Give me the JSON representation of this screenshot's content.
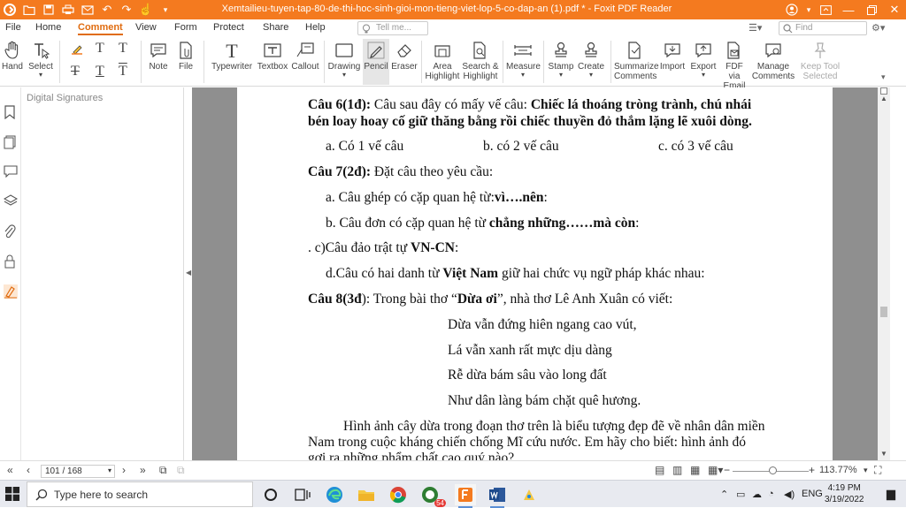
{
  "app": {
    "window_title": "Xemtailieu-tuyen-tap-80-de-thi-hoc-sinh-gioi-mon-tieng-viet-lop-5-co-dap-an (1).pdf * - Foxit PDF Reader",
    "accent_color": "#f47a1f"
  },
  "menu": {
    "tabs": [
      {
        "label": "File"
      },
      {
        "label": "Home"
      },
      {
        "label": "Comment"
      },
      {
        "label": "View"
      },
      {
        "label": "Form"
      },
      {
        "label": "Protect"
      },
      {
        "label": "Share"
      },
      {
        "label": "Help"
      }
    ],
    "active_tab": "Comment",
    "tell_me_placeholder": "Tell me...",
    "find_placeholder": "Find"
  },
  "ribbon": {
    "hand": "Hand",
    "select": "Select",
    "note": "Note",
    "file": "File",
    "typewriter": "Typewriter",
    "textbox": "Textbox",
    "callout": "Callout",
    "drawing": "Drawing",
    "pencil": "Pencil",
    "eraser": "Eraser",
    "area_highlight_1": "Area",
    "area_highlight_2": "Highlight",
    "search_highlight_1": "Search &",
    "search_highlight_2": "Highlight",
    "measure": "Measure",
    "stamp": "Stamp",
    "create": "Create",
    "summarize_1": "Summarize",
    "summarize_2": "Comments",
    "import": "Import",
    "export": "Export",
    "fdf_1": "FDF via",
    "fdf_2": "Email",
    "manage_1": "Manage",
    "manage_2": "Comments",
    "keep_1": "Keep Tool",
    "keep_2": "Selected"
  },
  "sidepanel": {
    "header": "Digital Signatures"
  },
  "document": {
    "lines": [
      {
        "kind": "mixed",
        "parts": [
          {
            "t": "Câu 6(1đ):",
            "b": true
          },
          {
            "t": " Câu sau đây có mấy vế câu: ",
            "b": false
          },
          {
            "t": "Chiếc lá thoáng tròng trành, chú nhái",
            "b": true
          }
        ]
      },
      {
        "kind": "mixed",
        "parts": [
          {
            "t": "bén loay hoay cố giữ thăng bằng rồi chiếc thuyền đỏ thắm lặng lẽ xuôi dòng.",
            "b": true
          }
        ]
      },
      {
        "kind": "choices",
        "a": "a.  Có 1 vế câu",
        "b": "b. có 2 vế câu",
        "c": "c. có 3 vế câu"
      },
      {
        "kind": "mixed",
        "parts": [
          {
            "t": "Câu 7(2đ):",
            "b": true
          },
          {
            "t": " Đặt câu theo yêu cầu:",
            "b": false
          }
        ]
      },
      {
        "kind": "mixed",
        "parts": [
          {
            "t": "a.  Câu ghép có cặp quan hệ từ:",
            "b": false
          },
          {
            "t": "vì….nên",
            "b": true
          },
          {
            "t": ":",
            "b": false
          }
        ]
      },
      {
        "kind": "mixed",
        "parts": [
          {
            "t": "b.  Câu đơn có cặp quan hệ từ ",
            "b": false
          },
          {
            "t": "chẳng những……mà còn",
            "b": true
          },
          {
            "t": ":",
            "b": false
          }
        ]
      },
      {
        "kind": "mixed",
        "parts": [
          {
            "t": ".    c)Câu đảo trật tự ",
            "b": false
          },
          {
            "t": "VN-CN",
            "b": true
          },
          {
            "t": ":",
            "b": false
          }
        ]
      },
      {
        "kind": "mixed",
        "parts": [
          {
            "t": "d.Câu có hai danh từ ",
            "b": false
          },
          {
            "t": "Việt Nam",
            "b": true
          },
          {
            "t": " giữ hai chức vụ ngữ pháp khác nhau:",
            "b": false
          }
        ]
      },
      {
        "kind": "mixed",
        "parts": [
          {
            "t": "Câu 8(3đ",
            "b": true
          },
          {
            "t": "): Trong bài thơ “",
            "b": false
          },
          {
            "t": "Dừa ơi",
            "b": true
          },
          {
            "t": "”, nhà thơ Lê Anh Xuân có viết:",
            "b": false
          }
        ]
      },
      {
        "kind": "mixed",
        "parts": [
          {
            "t": "Dừa vẫn đứng hiên ngang cao vút,",
            "b": false
          }
        ]
      },
      {
        "kind": "mixed",
        "parts": [
          {
            "t": "Lá vẫn xanh rất mực dịu dàng",
            "b": false
          }
        ]
      },
      {
        "kind": "mixed",
        "parts": [
          {
            "t": "Rễ dừa bám sâu vào long đất",
            "b": false
          }
        ]
      },
      {
        "kind": "mixed",
        "parts": [
          {
            "t": "Như dân làng bám chặt quê hương.",
            "b": false
          }
        ]
      },
      {
        "kind": "mixed",
        "parts": [
          {
            "t": "Hình ảnh cây dừa trong đoạn thơ trên là biểu tượng đẹp đẽ về nhân dân miền",
            "b": false
          }
        ]
      },
      {
        "kind": "mixed",
        "parts": [
          {
            "t": "Nam trong cuộc kháng chiến chống Mĩ cứu nước. Em hãy cho biết: hình ảnh đó",
            "b": false
          }
        ]
      },
      {
        "kind": "mixed",
        "parts": [
          {
            "t": "gợi ra những phẩm chất cao quý nào?",
            "b": false
          }
        ]
      }
    ]
  },
  "statusbar": {
    "page_indicator": "101 / 168",
    "zoom": "113.77%"
  },
  "taskbar": {
    "search_placeholder": "Type here to search",
    "language": "ENG",
    "time": "4:19 PM",
    "date": "3/19/2022",
    "badge_count": "54"
  }
}
